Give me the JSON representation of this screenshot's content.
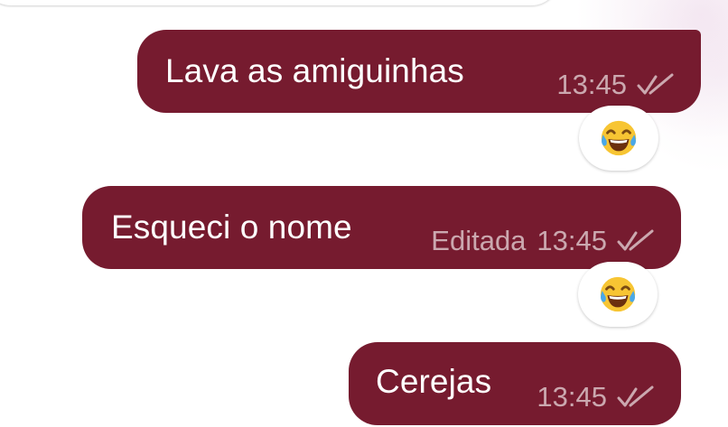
{
  "theme": {
    "bubble_color": "#761b2f",
    "meta_color": "#d9b5bd",
    "reaction_bg": "#ffffff"
  },
  "messages": [
    {
      "text": "Lava as amiguinhas",
      "edited_label": "",
      "time": "13:45",
      "status_icon": "double-check-icon",
      "reaction": "face-with-tears-of-joy-emoji"
    },
    {
      "text": "Esqueci o nome",
      "edited_label": "Editada",
      "time": "13:45",
      "status_icon": "double-check-icon",
      "reaction": "face-with-tears-of-joy-emoji"
    },
    {
      "text": "Cerejas",
      "edited_label": "",
      "time": "13:45",
      "status_icon": "double-check-icon",
      "reaction": ""
    }
  ]
}
